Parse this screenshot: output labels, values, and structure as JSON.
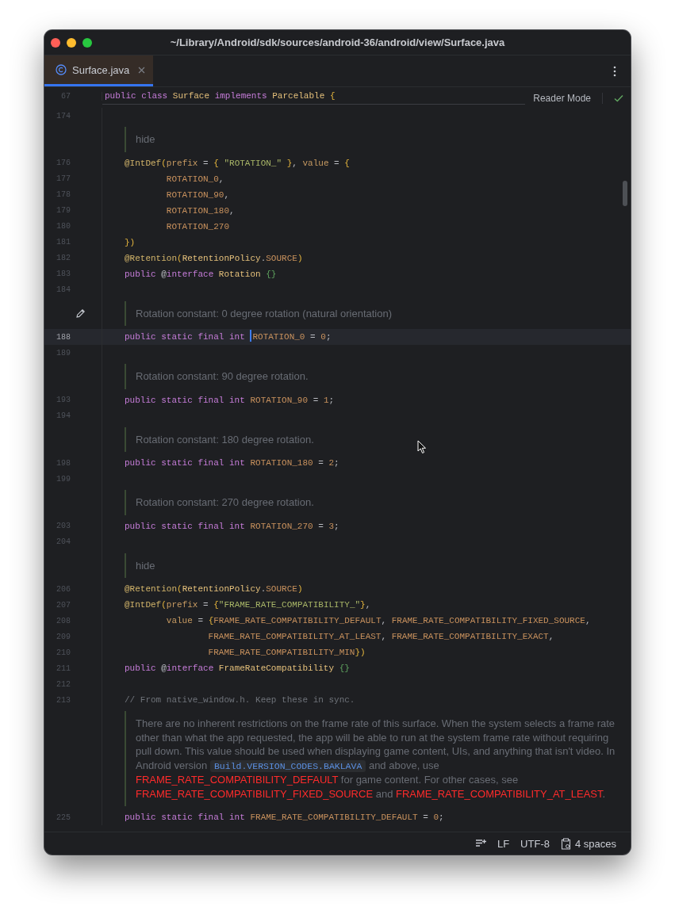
{
  "window": {
    "title": "~/Library/Android/sdk/sources/android-36/android/view/Surface.java"
  },
  "tabs": [
    {
      "label": "Surface.java",
      "selected": true
    }
  ],
  "reader_mode": "Reader Mode",
  "sticky_line": {
    "number": "67",
    "tokens": [
      {
        "kind": "kw",
        "t": "public class "
      },
      {
        "kind": "type",
        "t": "Surface"
      },
      {
        "kind": "kw",
        "t": " implements "
      },
      {
        "kind": "type",
        "t": "Parcelable"
      },
      {
        "kind": "brace",
        "t": " {"
      }
    ]
  },
  "rows": [
    {
      "kind": "code",
      "number": "174",
      "current": false,
      "tokens": []
    },
    {
      "kind": "doc",
      "pencil": false,
      "segments": [
        {
          "kind": "text",
          "t": "hide"
        }
      ]
    },
    {
      "kind": "code",
      "number": "176",
      "current": false,
      "tokens": [
        {
          "kind": "ann",
          "t": "@IntDef"
        },
        {
          "kind": "brace",
          "t": "("
        },
        {
          "kind": "param",
          "t": "prefix"
        },
        {
          "kind": "punct",
          "t": " = "
        },
        {
          "kind": "brace",
          "t": "{ "
        },
        {
          "kind": "str",
          "t": "\"ROTATION_\""
        },
        {
          "kind": "brace",
          "t": " }"
        },
        {
          "kind": "punct",
          "t": ", "
        },
        {
          "kind": "param",
          "t": "value"
        },
        {
          "kind": "punct",
          "t": " = "
        },
        {
          "kind": "brace",
          "t": "{"
        }
      ]
    },
    {
      "kind": "code",
      "number": "177",
      "current": false,
      "tokens": [
        {
          "kind": "const",
          "t": "        ROTATION_0"
        },
        {
          "kind": "punct",
          "t": ","
        }
      ]
    },
    {
      "kind": "code",
      "number": "178",
      "current": false,
      "tokens": [
        {
          "kind": "const",
          "t": "        ROTATION_90"
        },
        {
          "kind": "punct",
          "t": ","
        }
      ]
    },
    {
      "kind": "code",
      "number": "179",
      "current": false,
      "tokens": [
        {
          "kind": "const",
          "t": "        ROTATION_180"
        },
        {
          "kind": "punct",
          "t": ","
        }
      ]
    },
    {
      "kind": "code",
      "number": "180",
      "current": false,
      "tokens": [
        {
          "kind": "const",
          "t": "        ROTATION_270"
        }
      ]
    },
    {
      "kind": "code",
      "number": "181",
      "current": false,
      "tokens": [
        {
          "kind": "brace",
          "t": "})"
        }
      ]
    },
    {
      "kind": "code",
      "number": "182",
      "current": false,
      "tokens": [
        {
          "kind": "ann",
          "t": "@Retention"
        },
        {
          "kind": "brace",
          "t": "("
        },
        {
          "kind": "type",
          "t": "RetentionPolicy"
        },
        {
          "kind": "punct",
          "t": "."
        },
        {
          "kind": "const",
          "t": "SOURCE"
        },
        {
          "kind": "brace",
          "t": ")"
        }
      ]
    },
    {
      "kind": "code",
      "number": "183",
      "current": false,
      "tokens": [
        {
          "kind": "kw",
          "t": "public "
        },
        {
          "kind": "punct",
          "t": "@"
        },
        {
          "kind": "kw",
          "t": "interface "
        },
        {
          "kind": "type",
          "t": "Rotation "
        },
        {
          "kind": "braceg",
          "t": "{}"
        }
      ]
    },
    {
      "kind": "code",
      "number": "184",
      "current": false,
      "tokens": []
    },
    {
      "kind": "doc",
      "pencil": true,
      "segments": [
        {
          "kind": "text",
          "t": "Rotation constant: 0 degree rotation (natural orientation)"
        }
      ]
    },
    {
      "kind": "code",
      "number": "188",
      "current": true,
      "tokens": [
        {
          "kind": "kw",
          "t": "public static final int "
        },
        {
          "kind": "caret"
        },
        {
          "kind": "const",
          "t": "ROTATION_0"
        },
        {
          "kind": "punct",
          "t": " = "
        },
        {
          "kind": "num",
          "t": "0"
        },
        {
          "kind": "punct",
          "t": ";"
        }
      ]
    },
    {
      "kind": "code",
      "number": "189",
      "current": false,
      "tokens": []
    },
    {
      "kind": "doc",
      "pencil": false,
      "segments": [
        {
          "kind": "text",
          "t": "Rotation constant: 90 degree rotation."
        }
      ]
    },
    {
      "kind": "code",
      "number": "193",
      "current": false,
      "tokens": [
        {
          "kind": "kw",
          "t": "public static final int "
        },
        {
          "kind": "const",
          "t": "ROTATION_90"
        },
        {
          "kind": "punct",
          "t": " = "
        },
        {
          "kind": "num",
          "t": "1"
        },
        {
          "kind": "punct",
          "t": ";"
        }
      ]
    },
    {
      "kind": "code",
      "number": "194",
      "current": false,
      "tokens": []
    },
    {
      "kind": "doc",
      "pencil": false,
      "segments": [
        {
          "kind": "text",
          "t": "Rotation constant: 180 degree rotation."
        }
      ]
    },
    {
      "kind": "code",
      "number": "198",
      "current": false,
      "tokens": [
        {
          "kind": "kw",
          "t": "public static final int "
        },
        {
          "kind": "const",
          "t": "ROTATION_180"
        },
        {
          "kind": "punct",
          "t": " = "
        },
        {
          "kind": "num",
          "t": "2"
        },
        {
          "kind": "punct",
          "t": ";"
        }
      ]
    },
    {
      "kind": "code",
      "number": "199",
      "current": false,
      "tokens": []
    },
    {
      "kind": "doc",
      "pencil": false,
      "segments": [
        {
          "kind": "text",
          "t": "Rotation constant: 270 degree rotation."
        }
      ]
    },
    {
      "kind": "code",
      "number": "203",
      "current": false,
      "tokens": [
        {
          "kind": "kw",
          "t": "public static final int "
        },
        {
          "kind": "const",
          "t": "ROTATION_270"
        },
        {
          "kind": "punct",
          "t": " = "
        },
        {
          "kind": "num",
          "t": "3"
        },
        {
          "kind": "punct",
          "t": ";"
        }
      ]
    },
    {
      "kind": "code",
      "number": "204",
      "current": false,
      "tokens": []
    },
    {
      "kind": "doc",
      "pencil": false,
      "segments": [
        {
          "kind": "text",
          "t": "hide"
        }
      ]
    },
    {
      "kind": "code",
      "number": "206",
      "current": false,
      "tokens": [
        {
          "kind": "ann",
          "t": "@Retention"
        },
        {
          "kind": "brace",
          "t": "("
        },
        {
          "kind": "type",
          "t": "RetentionPolicy"
        },
        {
          "kind": "punct",
          "t": "."
        },
        {
          "kind": "const",
          "t": "SOURCE"
        },
        {
          "kind": "brace",
          "t": ")"
        }
      ]
    },
    {
      "kind": "code",
      "number": "207",
      "current": false,
      "tokens": [
        {
          "kind": "ann",
          "t": "@IntDef"
        },
        {
          "kind": "brace",
          "t": "("
        },
        {
          "kind": "param",
          "t": "prefix"
        },
        {
          "kind": "punct",
          "t": " = "
        },
        {
          "kind": "brace",
          "t": "{"
        },
        {
          "kind": "str",
          "t": "\"FRAME_RATE_COMPATIBILITY_\""
        },
        {
          "kind": "brace",
          "t": "}"
        },
        {
          "kind": "punct",
          "t": ","
        }
      ]
    },
    {
      "kind": "code",
      "number": "208",
      "current": false,
      "tokens": [
        {
          "kind": "param",
          "t": "        value"
        },
        {
          "kind": "punct",
          "t": " = "
        },
        {
          "kind": "brace",
          "t": "{"
        },
        {
          "kind": "const",
          "t": "FRAME_RATE_COMPATIBILITY_DEFAULT"
        },
        {
          "kind": "punct",
          "t": ", "
        },
        {
          "kind": "const",
          "t": "FRAME_RATE_COMPATIBILITY_FIXED_SOURCE"
        },
        {
          "kind": "punct",
          "t": ","
        }
      ]
    },
    {
      "kind": "code",
      "number": "209",
      "current": false,
      "tokens": [
        {
          "kind": "const",
          "t": "                FRAME_RATE_COMPATIBILITY_AT_LEAST"
        },
        {
          "kind": "punct",
          "t": ", "
        },
        {
          "kind": "const",
          "t": "FRAME_RATE_COMPATIBILITY_EXACT"
        },
        {
          "kind": "punct",
          "t": ","
        }
      ]
    },
    {
      "kind": "code",
      "number": "210",
      "current": false,
      "tokens": [
        {
          "kind": "const",
          "t": "                FRAME_RATE_COMPATIBILITY_MIN"
        },
        {
          "kind": "brace",
          "t": "})"
        }
      ]
    },
    {
      "kind": "code",
      "number": "211",
      "current": false,
      "tokens": [
        {
          "kind": "kw",
          "t": "public "
        },
        {
          "kind": "punct",
          "t": "@"
        },
        {
          "kind": "kw",
          "t": "interface "
        },
        {
          "kind": "type",
          "t": "FrameRateCompatibility "
        },
        {
          "kind": "braceg",
          "t": "{}"
        }
      ]
    },
    {
      "kind": "code",
      "number": "212",
      "current": false,
      "tokens": []
    },
    {
      "kind": "code",
      "number": "213",
      "current": false,
      "tokens": [
        {
          "kind": "comment",
          "t": "// From native_window.h. Keep these in sync."
        }
      ]
    },
    {
      "kind": "doc",
      "pencil": false,
      "segments": [
        {
          "kind": "text",
          "t": "There are no inherent restrictions on the frame rate of this surface. When the system selects a frame rate other than what the app requested, the app will be able to run at the system frame rate without requiring pull down. This value should be used when displaying game content, UIs, and anything that isn't video. In Android version "
        },
        {
          "kind": "code",
          "t": "Build.VERSION_CODES.BAKLAVA"
        },
        {
          "kind": "text",
          "t": " and above, use "
        },
        {
          "kind": "link",
          "t": "FRAME_RATE_COMPATIBILITY_DEFAULT"
        },
        {
          "kind": "text",
          "t": " for game content. For other cases, see "
        },
        {
          "kind": "link",
          "t": "FRAME_RATE_COMPATIBILITY_FIXED_SOURCE"
        },
        {
          "kind": "text",
          "t": " and "
        },
        {
          "kind": "link",
          "t": "FRAME_RATE_COMPATIBILITY_AT_LEAST"
        },
        {
          "kind": "text",
          "t": "."
        }
      ]
    },
    {
      "kind": "code",
      "number": "225",
      "current": false,
      "tokens": [
        {
          "kind": "kw",
          "t": "public static final int "
        },
        {
          "kind": "const",
          "t": "FRAME_RATE_COMPATIBILITY_DEFAULT"
        },
        {
          "kind": "punct",
          "t": " = "
        },
        {
          "kind": "num",
          "t": "0"
        },
        {
          "kind": "punct",
          "t": ";"
        }
      ]
    }
  ],
  "status_bar": {
    "line_separator": "LF",
    "encoding": "UTF-8",
    "indent": "4 spaces"
  }
}
